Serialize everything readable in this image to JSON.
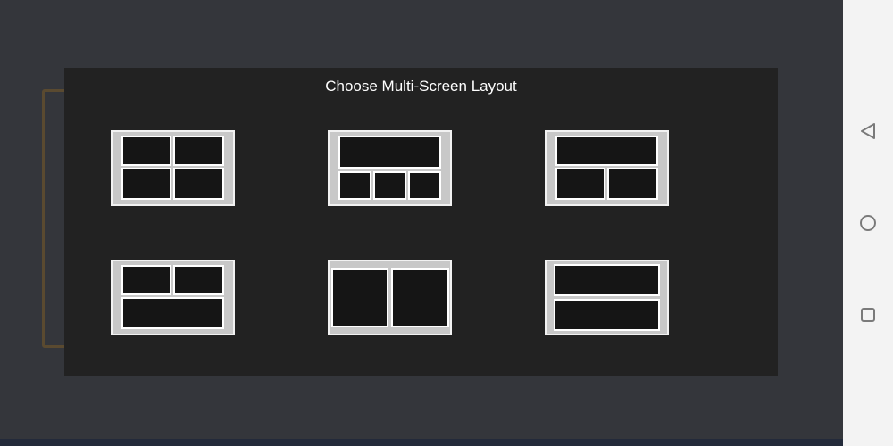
{
  "dialog": {
    "title": "Choose Multi-Screen Layout",
    "layouts": [
      {
        "name": "2x2 grid"
      },
      {
        "name": "1 top + 3 bottom"
      },
      {
        "name": "1 top + 2 bottom"
      },
      {
        "name": "2 top + 1 bottom"
      },
      {
        "name": "2 side by side"
      },
      {
        "name": "2 stacked"
      }
    ]
  },
  "background": {
    "add_icon": "+"
  },
  "navbar": {
    "back_icon": "triangle-back-icon",
    "home_icon": "circle-home-icon",
    "recents_icon": "square-recents-icon"
  },
  "colors": {
    "dialog_bg": "#222222",
    "tile_bg": "#c8c8c8",
    "cell_fill": "#151515"
  }
}
